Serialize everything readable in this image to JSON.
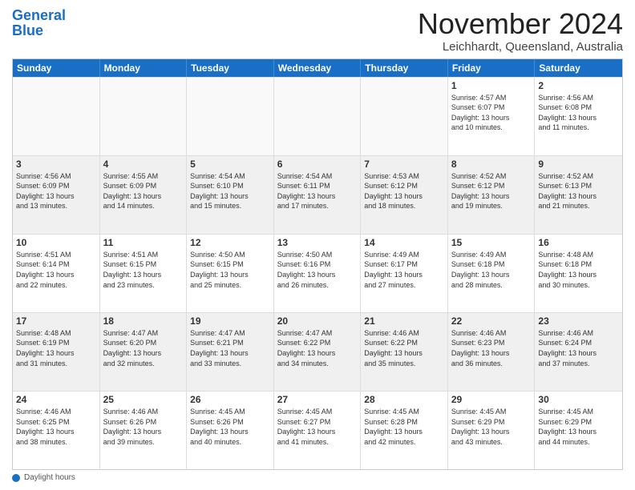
{
  "header": {
    "logo_line1": "General",
    "logo_line2": "Blue",
    "month": "November 2024",
    "location": "Leichhardt, Queensland, Australia"
  },
  "days_of_week": [
    "Sunday",
    "Monday",
    "Tuesday",
    "Wednesday",
    "Thursday",
    "Friday",
    "Saturday"
  ],
  "weeks": [
    [
      {
        "day": "",
        "info": "",
        "empty": true
      },
      {
        "day": "",
        "info": "",
        "empty": true
      },
      {
        "day": "",
        "info": "",
        "empty": true
      },
      {
        "day": "",
        "info": "",
        "empty": true
      },
      {
        "day": "",
        "info": "",
        "empty": true
      },
      {
        "day": "1",
        "info": "Sunrise: 4:57 AM\nSunset: 6:07 PM\nDaylight: 13 hours\nand 10 minutes.",
        "empty": false
      },
      {
        "day": "2",
        "info": "Sunrise: 4:56 AM\nSunset: 6:08 PM\nDaylight: 13 hours\nand 11 minutes.",
        "empty": false
      }
    ],
    [
      {
        "day": "3",
        "info": "Sunrise: 4:56 AM\nSunset: 6:09 PM\nDaylight: 13 hours\nand 13 minutes.",
        "empty": false
      },
      {
        "day": "4",
        "info": "Sunrise: 4:55 AM\nSunset: 6:09 PM\nDaylight: 13 hours\nand 14 minutes.",
        "empty": false
      },
      {
        "day": "5",
        "info": "Sunrise: 4:54 AM\nSunset: 6:10 PM\nDaylight: 13 hours\nand 15 minutes.",
        "empty": false
      },
      {
        "day": "6",
        "info": "Sunrise: 4:54 AM\nSunset: 6:11 PM\nDaylight: 13 hours\nand 17 minutes.",
        "empty": false
      },
      {
        "day": "7",
        "info": "Sunrise: 4:53 AM\nSunset: 6:12 PM\nDaylight: 13 hours\nand 18 minutes.",
        "empty": false
      },
      {
        "day": "8",
        "info": "Sunrise: 4:52 AM\nSunset: 6:12 PM\nDaylight: 13 hours\nand 19 minutes.",
        "empty": false
      },
      {
        "day": "9",
        "info": "Sunrise: 4:52 AM\nSunset: 6:13 PM\nDaylight: 13 hours\nand 21 minutes.",
        "empty": false
      }
    ],
    [
      {
        "day": "10",
        "info": "Sunrise: 4:51 AM\nSunset: 6:14 PM\nDaylight: 13 hours\nand 22 minutes.",
        "empty": false
      },
      {
        "day": "11",
        "info": "Sunrise: 4:51 AM\nSunset: 6:15 PM\nDaylight: 13 hours\nand 23 minutes.",
        "empty": false
      },
      {
        "day": "12",
        "info": "Sunrise: 4:50 AM\nSunset: 6:15 PM\nDaylight: 13 hours\nand 25 minutes.",
        "empty": false
      },
      {
        "day": "13",
        "info": "Sunrise: 4:50 AM\nSunset: 6:16 PM\nDaylight: 13 hours\nand 26 minutes.",
        "empty": false
      },
      {
        "day": "14",
        "info": "Sunrise: 4:49 AM\nSunset: 6:17 PM\nDaylight: 13 hours\nand 27 minutes.",
        "empty": false
      },
      {
        "day": "15",
        "info": "Sunrise: 4:49 AM\nSunset: 6:18 PM\nDaylight: 13 hours\nand 28 minutes.",
        "empty": false
      },
      {
        "day": "16",
        "info": "Sunrise: 4:48 AM\nSunset: 6:18 PM\nDaylight: 13 hours\nand 30 minutes.",
        "empty": false
      }
    ],
    [
      {
        "day": "17",
        "info": "Sunrise: 4:48 AM\nSunset: 6:19 PM\nDaylight: 13 hours\nand 31 minutes.",
        "empty": false
      },
      {
        "day": "18",
        "info": "Sunrise: 4:47 AM\nSunset: 6:20 PM\nDaylight: 13 hours\nand 32 minutes.",
        "empty": false
      },
      {
        "day": "19",
        "info": "Sunrise: 4:47 AM\nSunset: 6:21 PM\nDaylight: 13 hours\nand 33 minutes.",
        "empty": false
      },
      {
        "day": "20",
        "info": "Sunrise: 4:47 AM\nSunset: 6:22 PM\nDaylight: 13 hours\nand 34 minutes.",
        "empty": false
      },
      {
        "day": "21",
        "info": "Sunrise: 4:46 AM\nSunset: 6:22 PM\nDaylight: 13 hours\nand 35 minutes.",
        "empty": false
      },
      {
        "day": "22",
        "info": "Sunrise: 4:46 AM\nSunset: 6:23 PM\nDaylight: 13 hours\nand 36 minutes.",
        "empty": false
      },
      {
        "day": "23",
        "info": "Sunrise: 4:46 AM\nSunset: 6:24 PM\nDaylight: 13 hours\nand 37 minutes.",
        "empty": false
      }
    ],
    [
      {
        "day": "24",
        "info": "Sunrise: 4:46 AM\nSunset: 6:25 PM\nDaylight: 13 hours\nand 38 minutes.",
        "empty": false
      },
      {
        "day": "25",
        "info": "Sunrise: 4:46 AM\nSunset: 6:26 PM\nDaylight: 13 hours\nand 39 minutes.",
        "empty": false
      },
      {
        "day": "26",
        "info": "Sunrise: 4:45 AM\nSunset: 6:26 PM\nDaylight: 13 hours\nand 40 minutes.",
        "empty": false
      },
      {
        "day": "27",
        "info": "Sunrise: 4:45 AM\nSunset: 6:27 PM\nDaylight: 13 hours\nand 41 minutes.",
        "empty": false
      },
      {
        "day": "28",
        "info": "Sunrise: 4:45 AM\nSunset: 6:28 PM\nDaylight: 13 hours\nand 42 minutes.",
        "empty": false
      },
      {
        "day": "29",
        "info": "Sunrise: 4:45 AM\nSunset: 6:29 PM\nDaylight: 13 hours\nand 43 minutes.",
        "empty": false
      },
      {
        "day": "30",
        "info": "Sunrise: 4:45 AM\nSunset: 6:29 PM\nDaylight: 13 hours\nand 44 minutes.",
        "empty": false
      }
    ]
  ],
  "footer": {
    "label": "Daylight hours"
  }
}
